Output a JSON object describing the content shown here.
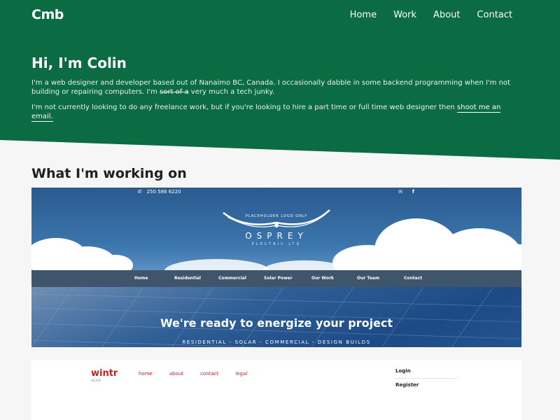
{
  "nav": {
    "brand": "Cmb",
    "links": [
      "Home",
      "Work",
      "About",
      "Contact"
    ]
  },
  "hero": {
    "title": "Hi, I'm Colin",
    "p1_start": "I'm a web designer and developer based out of Nanaimo BC, Canada. I occasionally dabble in some backend programming when I'm not building or repairing computers. I'm ",
    "p1_strike": "sort of a",
    "p1_end": " very much a tech junky.",
    "p2_text": "I'm not currently looking to do any freelance work, but if you're looking to hire a part time or full time web designer then ",
    "p2_link": "shoot me an email."
  },
  "work": {
    "title": "What I'm working on"
  },
  "project1": {
    "phone": "250 586 6220",
    "logo_small": "PLACEHOLDER LOGO ONLY",
    "logo_main": "OSPREY",
    "logo_sub": "ELECTRIC LTD",
    "nav": [
      "Home",
      "Residential",
      "Commercial",
      "Solar Power",
      "Our Work",
      "Our Team",
      "Contact"
    ],
    "headline": "We're ready to energize your project",
    "tagline": "RESIDENTIAL - SOLAR - COMMERCIAL - DESIGN BUILDS"
  },
  "project2": {
    "logo": "wintr",
    "logo_sub": "v0.21A",
    "links": [
      "home",
      "about",
      "contact",
      "legal"
    ],
    "login": "Login",
    "register": "Register"
  },
  "colors": {
    "primary_green": "#0b6b43",
    "page_bg": "#f6f6f6",
    "wintr_red": "#c4221f"
  }
}
